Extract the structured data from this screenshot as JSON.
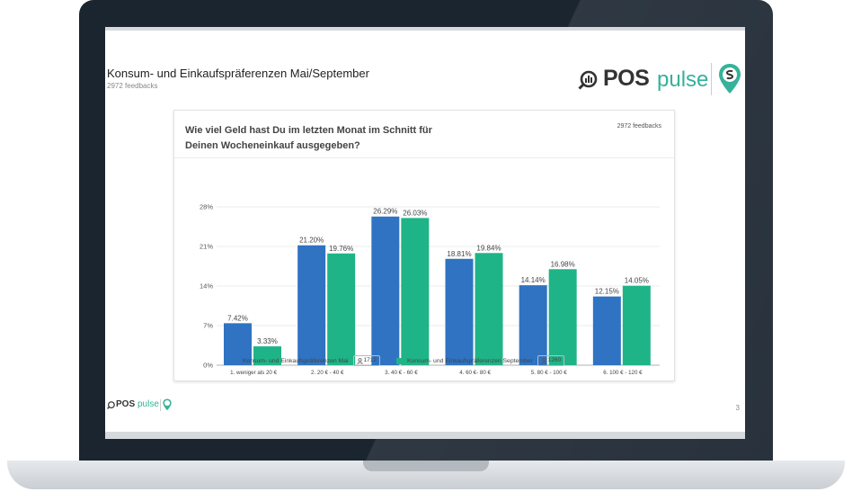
{
  "page": {
    "title": "Konsum- und Einkaufspräferenzen Mai/September",
    "subtitle": "2972 feedbacks",
    "page_number": "3"
  },
  "brand": {
    "pos": "POS",
    "pulse": "pulse"
  },
  "card": {
    "question_line1": "Wie viel Geld hast Du im letzten Monat im Schnitt für",
    "question_line2": "Deinen Wocheneinkauf ausgegeben?",
    "feedbacks": "2972 feedbacks"
  },
  "colors": {
    "series1": "#2f73c2",
    "series2": "#1fb487",
    "brand_green": "#35b29a"
  },
  "chart_data": {
    "type": "bar",
    "categories": [
      "1. weniger als 20 €",
      "2. 20 € - 40 €",
      "3. 40 € - 60 €",
      "4. 60 €- 80 €",
      "5. 80 € - 100 €",
      "6. 100 € - 120 €"
    ],
    "series": [
      {
        "name": "Konsum- und Einkaufspräferenzen Mai",
        "count": "1712",
        "values": [
          7.42,
          21.2,
          26.29,
          18.81,
          14.14,
          12.15
        ],
        "labels": [
          "7.42%",
          "21.20%",
          "26.29%",
          "18.81%",
          "14.14%",
          "12.15%"
        ]
      },
      {
        "name": "Konsum- und Einkaufspräferenzen September",
        "count": "1260",
        "values": [
          3.33,
          19.76,
          26.03,
          19.84,
          16.98,
          14.05
        ],
        "labels": [
          "3.33%",
          "19.76%",
          "26.03%",
          "19.84%",
          "16.98%",
          "14.05%"
        ]
      }
    ],
    "y_ticks": [
      "0%",
      "7%",
      "14%",
      "21%",
      "28%"
    ],
    "ylim": [
      0,
      28
    ],
    "grid": true,
    "legend_position": "bottom"
  }
}
